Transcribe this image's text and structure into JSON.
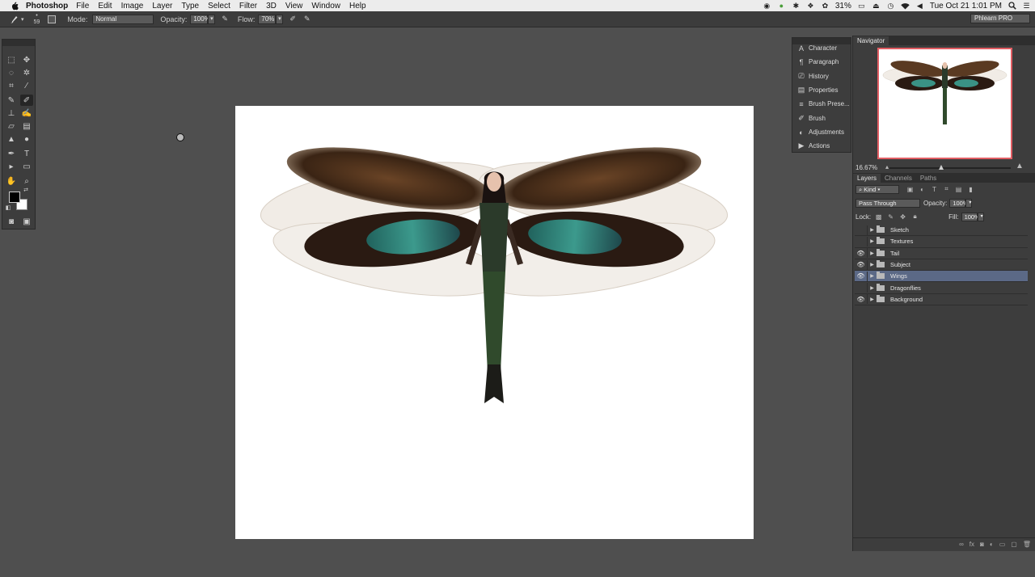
{
  "menubar": {
    "app_name": "Photoshop",
    "menus": [
      "File",
      "Edit",
      "Image",
      "Layer",
      "Type",
      "Select",
      "Filter",
      "3D",
      "View",
      "Window",
      "Help"
    ],
    "battery": "31%",
    "clock": "Tue Oct 21  1:01 PM"
  },
  "options": {
    "brush_size": "59",
    "mode_label": "Mode:",
    "mode_value": "Normal",
    "opacity_label": "Opacity:",
    "opacity_value": "100%",
    "flow_label": "Flow:",
    "flow_value": "70%",
    "workspace": "Phlearn PRO"
  },
  "dock": {
    "items": [
      {
        "label": "Character",
        "icon": "character-icon"
      },
      {
        "label": "Paragraph",
        "icon": "paragraph-icon"
      },
      {
        "label": "History",
        "icon": "history-icon"
      },
      {
        "label": "Properties",
        "icon": "properties-icon"
      },
      {
        "label": "Brush Prese...",
        "icon": "brush-presets-icon"
      },
      {
        "label": "Brush",
        "icon": "brush-icon"
      },
      {
        "label": "Adjustments",
        "icon": "adjustments-icon"
      },
      {
        "label": "Actions",
        "icon": "actions-icon"
      }
    ]
  },
  "navigator": {
    "tab": "Navigator",
    "zoom": "16.67%"
  },
  "layers_panel": {
    "tabs": [
      "Layers",
      "Channels",
      "Paths"
    ],
    "filter": "Kind",
    "blend_mode": "Pass Through",
    "opacity_label": "Opacity:",
    "opacity_value": "100%",
    "lock_label": "Lock:",
    "fill_label": "Fill:",
    "fill_value": "100%",
    "layers": [
      {
        "name": "Sketch",
        "visible": false,
        "selected": false
      },
      {
        "name": "Textures",
        "visible": false,
        "selected": false
      },
      {
        "name": "Tail",
        "visible": true,
        "selected": false
      },
      {
        "name": "Subject",
        "visible": true,
        "selected": false
      },
      {
        "name": "Wings",
        "visible": true,
        "selected": true
      },
      {
        "name": "Dragonflies",
        "visible": false,
        "selected": false
      },
      {
        "name": "Background",
        "visible": true,
        "selected": false
      }
    ]
  }
}
